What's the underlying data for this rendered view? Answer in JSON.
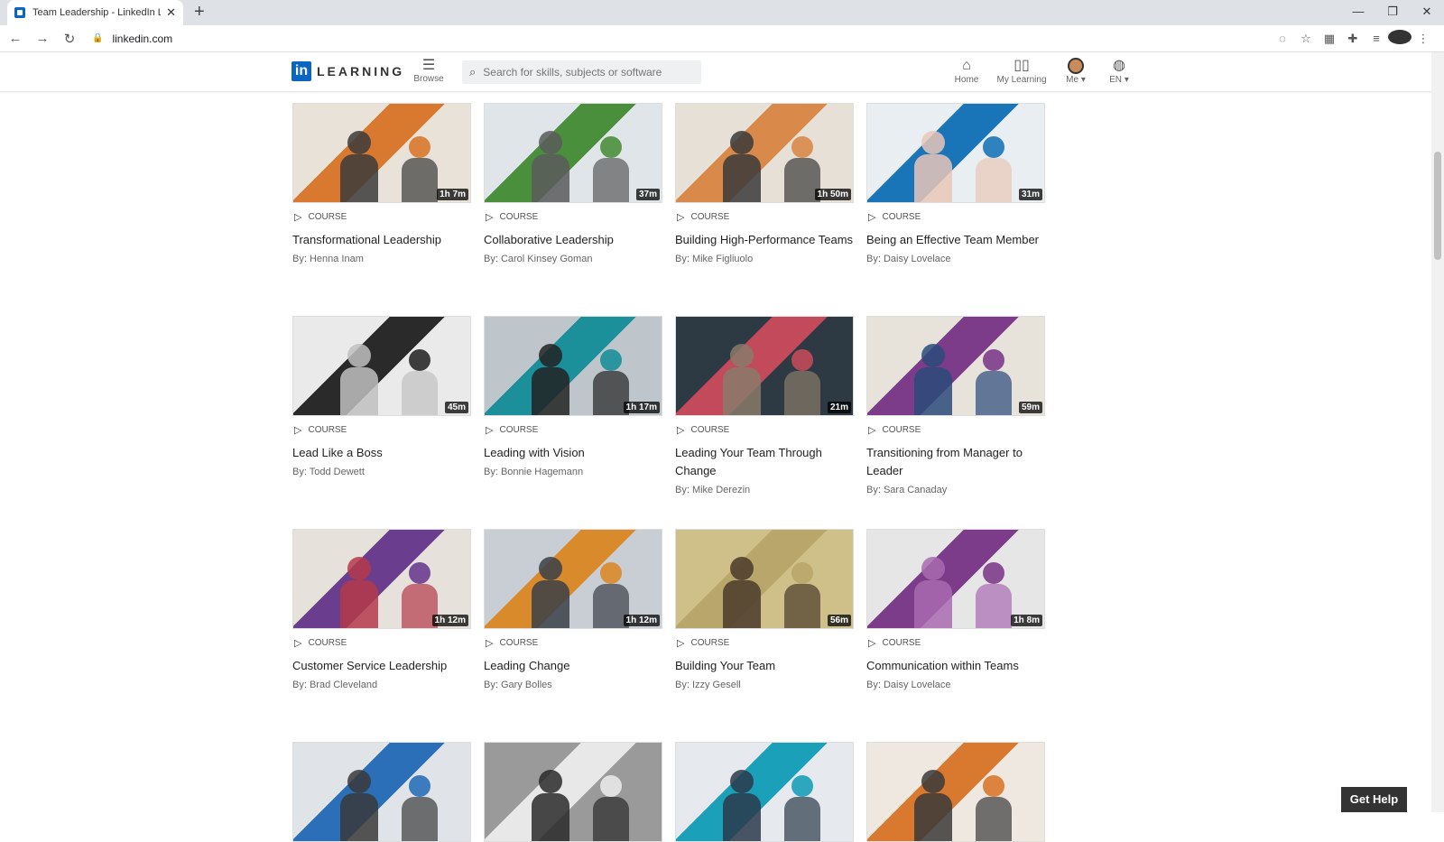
{
  "browser": {
    "tab_title": "Team Leadership - LinkedIn Learn",
    "tab_close": "✕",
    "new_tab": "+",
    "url": "linkedin.com"
  },
  "header": {
    "logo_in": "in",
    "logo_word": "LEARNING",
    "browse_label": "Browse",
    "search_placeholder": "Search for skills, subjects or software",
    "nav": {
      "home": "Home",
      "my_learning": "My Learning",
      "me": "Me",
      "lang": "EN"
    }
  },
  "courses": [
    {
      "type": "COURSE",
      "title": "Transformational Leadership",
      "author": "By: Henna Inam",
      "duration": "1h 7m",
      "colors": [
        "#d9782f",
        "#e8e2d8",
        "#3b3b3b"
      ]
    },
    {
      "type": "COURSE",
      "title": "Collaborative Leadership",
      "author": "By: Carol Kinsey Goman",
      "duration": "37m",
      "colors": [
        "#4a8f3c",
        "#dfe5e8",
        "#5a5a5a"
      ]
    },
    {
      "type": "COURSE",
      "title": "Building High-Performance Teams",
      "author": "By: Mike Figliuolo",
      "duration": "1h 50m",
      "colors": [
        "#d98a4a",
        "#e6e0d6",
        "#3a3a3a"
      ]
    },
    {
      "type": "COURSE",
      "title": "Being an Effective Team Member",
      "author": "By: Daisy Lovelace",
      "duration": "31m",
      "colors": [
        "#1a75b8",
        "#e8eef2",
        "#e9c7b8"
      ]
    },
    {
      "type": "COURSE",
      "title": "Lead Like a Boss",
      "author": "By: Todd Dewett",
      "duration": "45m",
      "colors": [
        "#2a2a2a",
        "#eaeaea",
        "#c0c0c0"
      ]
    },
    {
      "type": "COURSE",
      "title": "Leading with Vision",
      "author": "By: Bonnie Hagemann",
      "duration": "1h 17m",
      "colors": [
        "#1b8f9a",
        "#bfc6cb",
        "#222222"
      ]
    },
    {
      "type": "COURSE",
      "title": "Leading Your Team Through Change",
      "author": "By: Mike Derezin",
      "duration": "21m",
      "colors": [
        "#c24a5a",
        "#2d3a44",
        "#8a7a6a"
      ]
    },
    {
      "type": "COURSE",
      "title": "Transitioning from Manager to Leader",
      "author": "By: Sara Canaday",
      "duration": "59m",
      "colors": [
        "#7d3c8a",
        "#e7e2da",
        "#2a4a7a"
      ]
    },
    {
      "type": "COURSE",
      "title": "Customer Service Leadership",
      "author": "By: Brad Cleveland",
      "duration": "1h 12m",
      "colors": [
        "#6a3d8f",
        "#e6e1da",
        "#b53a4a"
      ]
    },
    {
      "type": "COURSE",
      "title": "Leading Change",
      "author": "By: Gary Bolles",
      "duration": "1h 12m",
      "colors": [
        "#d98a2a",
        "#c9ced4",
        "#3a4048"
      ]
    },
    {
      "type": "COURSE",
      "title": "Building Your Team",
      "author": "By: Izzy Gesell",
      "duration": "56m",
      "colors": [
        "#b8a66a",
        "#cfc08a",
        "#4a3a2a"
      ]
    },
    {
      "type": "COURSE",
      "title": "Communication within Teams",
      "author": "By: Daisy Lovelace",
      "duration": "1h 8m",
      "colors": [
        "#7d3c8a",
        "#e6e6e6",
        "#a86ab0"
      ]
    },
    {
      "type": "COURSE",
      "title": "",
      "author": "",
      "duration": "",
      "colors": [
        "#2a6fb8",
        "#e0e4e8",
        "#3a3a3a"
      ]
    },
    {
      "type": "COURSE",
      "title": "",
      "author": "",
      "duration": "",
      "colors": [
        "#e8e8e8",
        "#9a9a9a",
        "#2a2a2a"
      ]
    },
    {
      "type": "COURSE",
      "title": "",
      "author": "",
      "duration": "",
      "colors": [
        "#1aa0b8",
        "#e6eaee",
        "#2a3a4a"
      ]
    },
    {
      "type": "COURSE",
      "title": "",
      "author": "",
      "duration": "",
      "colors": [
        "#d9782f",
        "#eee8e0",
        "#3a3a3a"
      ]
    }
  ],
  "get_help": "Get Help"
}
